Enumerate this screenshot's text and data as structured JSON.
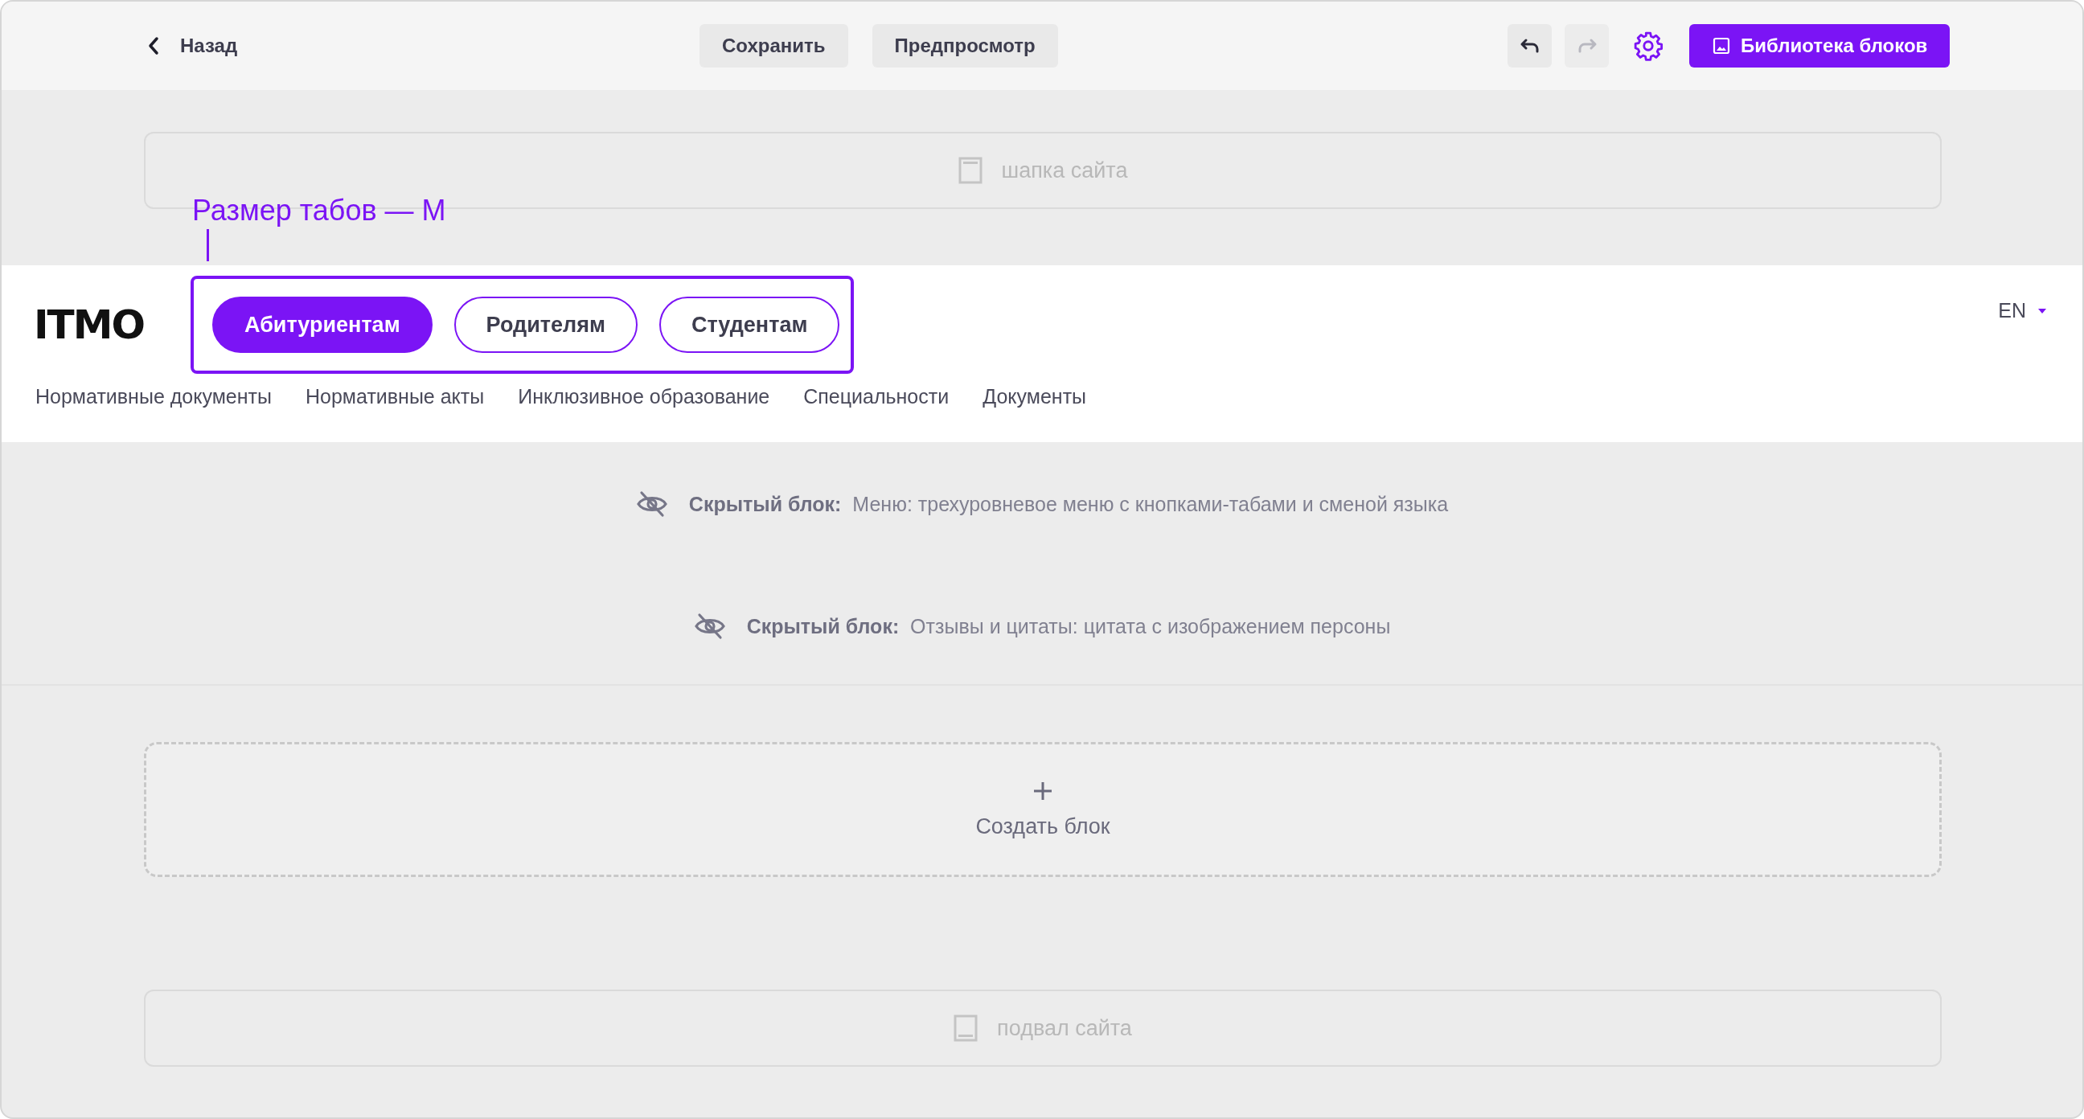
{
  "toolbar": {
    "back": "Назад",
    "buttons": [
      {
        "label": "Сохранить"
      },
      {
        "label": "Предпросмотр"
      }
    ],
    "history": [
      {
        "kind": "undo",
        "disabled": false
      },
      {
        "kind": "redo",
        "disabled": true
      }
    ],
    "library_button": "Библиотека блоков"
  },
  "header_placeholder": "шапка сайта",
  "annotation": "Размер табов — М",
  "site_menu": {
    "logo": "ITMO",
    "tabs": [
      {
        "label": "Абитуриентам",
        "selected": true
      },
      {
        "label": "Родителям",
        "selected": false
      },
      {
        "label": "Студентам",
        "selected": false
      }
    ],
    "language": "EN",
    "links": [
      "Нормативные документы",
      "Нормативные акты",
      "Инклюзивное образование",
      "Специальности",
      "Документы"
    ]
  },
  "hidden_blocks": [
    "**Скрытый блок:**  Меню: трехуровневое меню с кнопками-табами и сменой языка",
    "**Скрытый блок:**  Отзывы и цитаты: цитата с изображением персоны"
  ],
  "create_block": "Создать блок",
  "footer_placeholder": "подвал сайта"
}
